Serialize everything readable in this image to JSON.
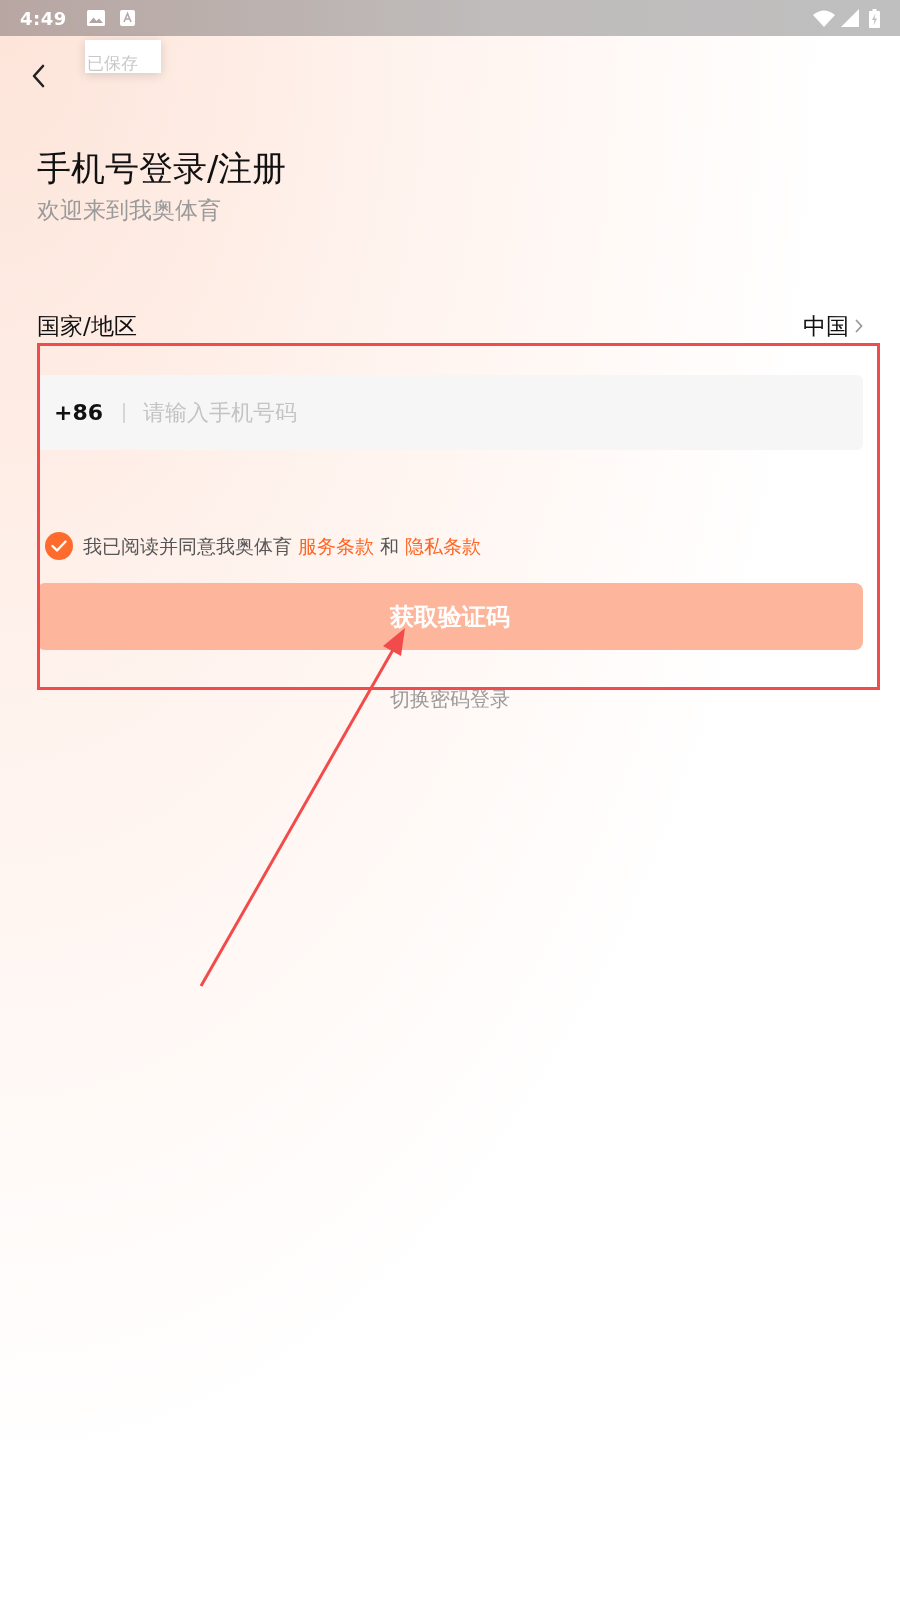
{
  "status_bar": {
    "time": "4:49"
  },
  "toast": {
    "text": "已保存"
  },
  "header": {
    "title": "手机号登录/注册",
    "subtitle": "欢迎来到我奥体育"
  },
  "region": {
    "label": "国家/地区",
    "value": "中国"
  },
  "phone_input": {
    "country_code": "+86",
    "placeholder": "请输入手机号码"
  },
  "agreement": {
    "checked": true,
    "text": "我已阅读并同意我奥体育",
    "terms_link": "服务条款",
    "conjunction": "和",
    "privacy_link": "隐私条款"
  },
  "submit_button": {
    "label": "获取验证码",
    "disabled": true
  },
  "switch_link": {
    "label": "切换密码登录"
  }
}
